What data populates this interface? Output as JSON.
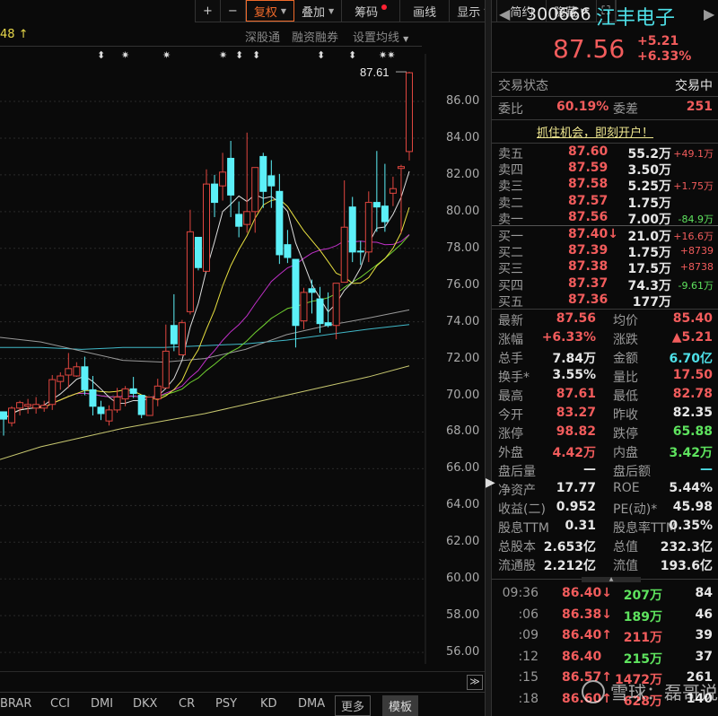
{
  "toolbar": {
    "plus": "+",
    "minus": "−",
    "fuquan": "复权",
    "overlay": "叠加",
    "chips": "筹码",
    "draw": "画线",
    "display": "显示",
    "simple": "简约",
    "hide": "隐藏",
    "hide_arrow": "▸▸",
    "fullscreen": "⛶"
  },
  "subbar": {
    "ma_label": "48 ↑",
    "sgt": "深股通",
    "margin": "融资融券",
    "set_ma": "设置均线"
  },
  "marks": [
    "⬍",
    "✷",
    "✷",
    "✷",
    "⬍",
    "⬍",
    "⬍",
    "⬍",
    "✷✷"
  ],
  "chart_data": {
    "type": "candlestick",
    "ylim": [
      55,
      89
    ],
    "yticks": [
      "86.00",
      "84.00",
      "82.00",
      "80.00",
      "78.00",
      "76.00",
      "74.00",
      "72.00",
      "70.00",
      "68.00",
      "66.00",
      "64.00",
      "62.00",
      "60.00",
      "58.00",
      "56.00"
    ],
    "high_label": "87.61",
    "colors": {
      "up": "#e0463f",
      "down": "#5cf0f8",
      "ma5": "#dddddd",
      "ma10": "#e8e040",
      "ma20": "#c030c8",
      "ma30": "#70d030",
      "ma60": "#999999",
      "ma120": "#40b8c8",
      "ma250": "#c8c870"
    },
    "candles": [
      [
        69.1,
        68.7,
        69.1,
        67.8
      ],
      [
        68.5,
        69.3,
        69.4,
        68.3
      ],
      [
        69.3,
        69.6,
        69.7,
        68.9
      ],
      [
        69.4,
        69.5,
        69.8,
        69.0
      ],
      [
        69.3,
        69.5,
        69.9,
        69.0
      ],
      [
        69.3,
        69.45,
        69.7,
        69.1
      ],
      [
        69.5,
        70.85,
        71.1,
        69.2
      ],
      [
        70.75,
        71.05,
        71.25,
        70.3
      ],
      [
        71.1,
        71.45,
        72.3,
        70.4
      ],
      [
        71.05,
        71.55,
        71.8,
        71.0
      ],
      [
        71.55,
        70.3,
        72.1,
        70.0
      ],
      [
        70.3,
        69.4,
        71.05,
        68.9
      ],
      [
        69.35,
        69.0,
        69.7,
        68.65
      ],
      [
        68.6,
        69.2,
        69.45,
        68.35
      ],
      [
        69.2,
        69.9,
        70.4,
        69.05
      ],
      [
        69.8,
        70.35,
        70.5,
        69.4
      ],
      [
        70.35,
        70.1,
        71.0,
        69.85
      ],
      [
        70.0,
        68.95,
        70.0,
        68.75
      ],
      [
        68.9,
        69.9,
        69.9,
        68.9
      ],
      [
        69.8,
        70.5,
        70.9,
        69.4
      ],
      [
        70.4,
        72.4,
        73.85,
        70.4
      ],
      [
        73.8,
        72.8,
        75.5,
        72.4
      ],
      [
        72.2,
        73.95,
        74.1,
        72.2
      ],
      [
        74.55,
        78.9,
        80.1,
        74.4
      ],
      [
        78.6,
        76.95,
        78.6,
        76.8
      ],
      [
        76.75,
        81.5,
        82.3,
        76.75
      ],
      [
        81.5,
        80.5,
        82.0,
        79.7
      ],
      [
        81.4,
        82.15,
        83.2,
        80.6
      ],
      [
        82.9,
        80.9,
        83.85,
        79.7
      ],
      [
        79.85,
        79.2,
        80.55,
        78.6
      ],
      [
        79.3,
        80.0,
        84.3,
        78.85
      ],
      [
        80.0,
        82.4,
        82.4,
        78.85
      ],
      [
        83.0,
        81.1,
        83.2,
        80.2
      ],
      [
        81.95,
        81.4,
        82.8,
        80.2
      ],
      [
        81.1,
        77.65,
        82.05,
        77.15
      ],
      [
        78.2,
        77.5,
        79.0,
        77.2
      ],
      [
        77.4,
        73.8,
        77.4,
        72.6
      ],
      [
        74.05,
        75.6,
        75.85,
        73.6
      ],
      [
        75.8,
        75.6,
        76.3,
        74.45
      ],
      [
        75.25,
        73.9,
        75.9,
        73.4
      ],
      [
        73.95,
        73.8,
        75.6,
        73.7
      ],
      [
        73.8,
        76.1,
        76.1,
        73.05
      ],
      [
        76.15,
        79.15,
        81.7,
        76.15
      ],
      [
        80.25,
        77.8,
        80.8,
        77.25
      ],
      [
        77.85,
        77.8,
        78.4,
        77.1
      ],
      [
        77.8,
        80.5,
        81.1,
        77.25
      ],
      [
        80.5,
        80.25,
        83.3,
        78.9
      ],
      [
        80.3,
        79.45,
        82.6,
        78.9
      ],
      [
        81.0,
        81.25,
        81.9,
        80.3
      ],
      [
        82.35,
        82.45,
        82.55,
        78.8
      ],
      [
        83.27,
        87.56,
        87.61,
        82.78
      ]
    ],
    "ma60": [
      73.15,
      72.9,
      72.4,
      71.9,
      71.8,
      72.0,
      72.5,
      73.3,
      73.8,
      74.2,
      74.65
    ],
    "ma120": [
      72.6,
      72.6,
      72.5,
      72.6,
      72.6,
      72.7,
      72.8,
      73.0,
      73.3,
      73.6,
      73.85
    ],
    "ma250": [
      66.5,
      67.2,
      67.7,
      68.2,
      68.6,
      69.0,
      69.5,
      70.0,
      70.5,
      71.0,
      71.6
    ]
  },
  "quote": {
    "code": "300666",
    "name": "江丰电子",
    "price": "87.56",
    "change": "+5.21",
    "pct": "+6.33%",
    "status_label": "交易状态",
    "status": "交易中",
    "wb_label": "委比",
    "wb": "60.19%",
    "wc_label": "委差",
    "wc": "251",
    "banner": "抓住机会，即刻开户！",
    "asks": [
      {
        "label": "卖五",
        "price": "87.60",
        "vol": "55.2万",
        "delta": "+49.1万",
        "dc": "red"
      },
      {
        "label": "卖四",
        "price": "87.59",
        "vol": "3.50万",
        "delta": "",
        "dc": "red"
      },
      {
        "label": "卖三",
        "price": "87.58",
        "vol": "5.25万",
        "delta": "+1.75万",
        "dc": "red"
      },
      {
        "label": "卖二",
        "price": "87.57",
        "vol": "1.75万",
        "delta": "",
        "dc": "red"
      },
      {
        "label": "卖一",
        "price": "87.56",
        "vol": "7.00万",
        "delta": "-84.9万",
        "dc": "grn"
      }
    ],
    "bids": [
      {
        "label": "买一",
        "price": "87.40↓",
        "vol": "21.0万",
        "delta": "+16.6万",
        "dc": "red"
      },
      {
        "label": "买二",
        "price": "87.39",
        "vol": "1.75万",
        "delta": "+8739",
        "dc": "red"
      },
      {
        "label": "买三",
        "price": "87.38",
        "vol": "17.5万",
        "delta": "+8738",
        "dc": "red"
      },
      {
        "label": "买四",
        "price": "87.37",
        "vol": "74.3万",
        "delta": "-9.61万",
        "dc": "grn"
      },
      {
        "label": "买五",
        "price": "87.36",
        "vol": "177万",
        "delta": "",
        "dc": "red"
      }
    ],
    "stats": [
      [
        "最新",
        "87.56",
        "red",
        "均价",
        "85.40",
        "red"
      ],
      [
        "涨幅",
        "+6.33%",
        "red",
        "涨跌",
        "▲5.21",
        "red"
      ],
      [
        "总手",
        "7.84万",
        "wht",
        "金额",
        "6.70亿",
        "cyan"
      ],
      [
        "换手*",
        "3.55%",
        "wht",
        "量比",
        "17.50",
        "red"
      ],
      [
        "最高",
        "87.61",
        "red",
        "最低",
        "82.78",
        "red"
      ],
      [
        "今开",
        "83.27",
        "red",
        "昨收",
        "82.35",
        "wht"
      ],
      [
        "涨停",
        "98.82",
        "red",
        "跌停",
        "65.88",
        "grn"
      ],
      [
        "外盘",
        "4.42万",
        "red",
        "内盘",
        "3.42万",
        "grn"
      ],
      [
        "盘后量",
        "—",
        "wht",
        "盘后额",
        "—",
        "cyan"
      ],
      [
        "净资产",
        "17.77",
        "wht",
        "ROE",
        "5.44%",
        "wht"
      ],
      [
        "收益(二)",
        "0.952",
        "wht",
        "PE(动)*",
        "45.98",
        "wht"
      ],
      [
        "股息TTM",
        "0.31",
        "wht",
        "股息率TTM",
        "0.35%",
        "wht"
      ],
      [
        "总股本",
        "2.653亿",
        "wht",
        "总值",
        "232.3亿",
        "wht"
      ],
      [
        "流通股",
        "2.212亿",
        "wht",
        "流值",
        "193.6亿",
        "wht"
      ]
    ],
    "ticks": [
      {
        "time": "09:36",
        "price": "86.40↓",
        "pc": "grn",
        "vol": "207万",
        "vc": "grn",
        "n": "84"
      },
      {
        "time": ":06",
        "price": "86.38↓",
        "pc": "grn",
        "vol": "189万",
        "vc": "grn",
        "n": "46"
      },
      {
        "time": ":09",
        "price": "86.40↑",
        "pc": "red",
        "vol": "211万",
        "vc": "red",
        "n": "39"
      },
      {
        "time": ":12",
        "price": "86.40",
        "pc": "red",
        "vol": "215万",
        "vc": "grn",
        "n": "37"
      },
      {
        "time": ":15",
        "price": "86.57↑",
        "pc": "red",
        "vol": "1472万",
        "vc": "red",
        "n": "261"
      },
      {
        "time": ":18",
        "price": "86.60↑",
        "pc": "red",
        "vol": "628万",
        "vc": "red",
        "n": "140"
      }
    ]
  },
  "bottom_tabs": [
    "BRAR",
    "CCI",
    "DMI",
    "DKX",
    "CR",
    "PSY",
    "KD",
    "DMA"
  ],
  "more": "更多",
  "template": "模板",
  "expand": "≫",
  "watermark": "雪球：磊哥说"
}
